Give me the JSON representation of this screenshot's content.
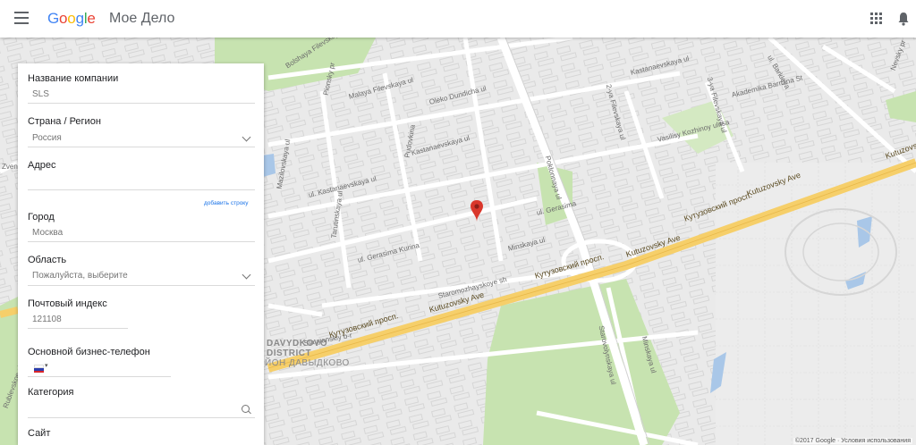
{
  "header": {
    "logo_letters": [
      "G",
      "o",
      "o",
      "g",
      "l",
      "e"
    ],
    "product": "Мое Дело",
    "menu_icon": "hamburger-menu-icon",
    "apps_icon": "apps-grid-icon",
    "notifications_icon": "bell-icon"
  },
  "form": {
    "company": {
      "label": "Название компании",
      "value": "SLS"
    },
    "country": {
      "label": "Страна / Регион",
      "value": "Россия"
    },
    "address": {
      "label": "Адрес",
      "value": "",
      "add_line": "добавить строку"
    },
    "city": {
      "label": "Город",
      "value": "Москва"
    },
    "region": {
      "label": "Область",
      "value": "Пожалуйста, выберите"
    },
    "postal": {
      "label": "Почтовый индекс",
      "value": "121108"
    },
    "phone": {
      "label": "Основной бизнес-телефон",
      "prefix": "▾"
    },
    "category": {
      "label": "Категория",
      "value": ""
    },
    "site": {
      "label": "Сайт"
    }
  },
  "map": {
    "streets": [
      "Malaya Filevskaya ul",
      "Bolshaya Filevskaya",
      "Pionsky pr",
      "Oleko Dundicha ul",
      "Kastanaevskaya ul",
      "Kastanaevskaya ul",
      "ul. Kastanaevskaya ul",
      "Tarutinskaya ul",
      "Mazilovskaya ul",
      "Rublevskoe sh",
      "ul. Gerasima Kurina",
      "ul. Gerasima",
      "Minskaya ul",
      "Staromozhayskoye sh",
      "Slavyanskiy b-r",
      "Vasilisy Kozhinoy ulitsa",
      "2-ya Filevskaya ul",
      "3-ya Filevskaya ul",
      "Akademika Barmina St",
      "ul. Barkleya",
      "Minskaya ul",
      "Starovolynskaya ul",
      "Nevsky pr",
      "Zvenigorodskaya",
      "Poklonnaya ul",
      "Pudovkina"
    ],
    "highways": [
      "Кутузовский просп.",
      "Kutuzovsky Ave",
      "Кутузовский просп.",
      "Kutuzovsky Ave",
      "Kutuzovsky Ave",
      "Кутузовский просп.",
      "Kutuzovsky Ave"
    ],
    "district_lines": [
      "DAVYDKOVO",
      "DISTRICT",
      "ЙОН ДАВЫДКОВО"
    ],
    "copyright": "©2017 Google · Условия использования"
  },
  "colors": {
    "park": "#c7e3b0",
    "water": "#a9c7e8",
    "highway": "#f6cf6a",
    "pin": "#d9372b"
  }
}
